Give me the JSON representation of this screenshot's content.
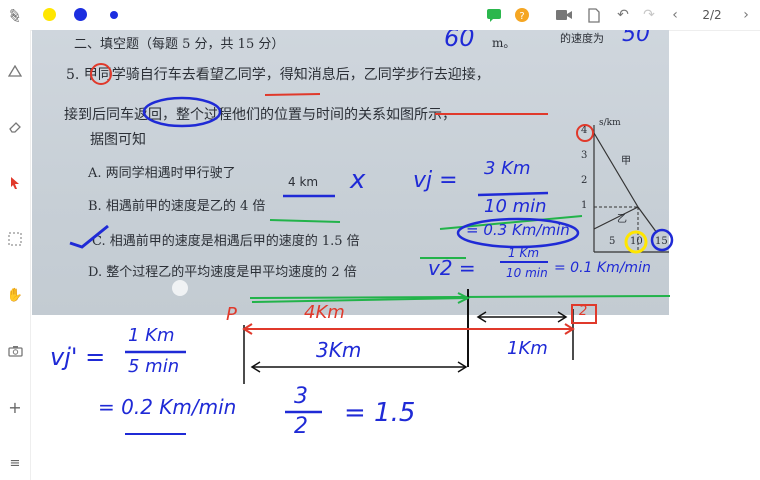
{
  "toolbar": {
    "pager": "2/2",
    "colors": {
      "yellow": "#ffe600",
      "blue": "#1c2ee0",
      "green": "#2bb74d",
      "orange": "#f5a623"
    }
  },
  "sidebar": {
    "tools": [
      "pen-icon",
      "shape-icon",
      "eraser-icon",
      "pointer-icon",
      "select-icon",
      "hand-icon",
      "camera-icon",
      "add-icon",
      "menu-icon"
    ]
  },
  "photo": {
    "header_line": "二、填空题（每题 5 分，共 15 分）",
    "header_answer": "60",
    "header_unit": "m。",
    "header_right": "的速度为",
    "header_right_answer": "50",
    "q5_line1": "5. 甲同学骑自行车去看望乙同学，得知消息后，乙同学步行去迎接，",
    "q5_line2": "接到后同车返回，整个过程他们的位置与时间的关系如图所示，",
    "q5_line3": "据图可知",
    "optA": "A.  两同学相遇时甲行驶了",
    "optA_ans": "4 km",
    "optB": "B.  相遇前甲的速度是乙的 4 倍",
    "optC": "C.  相遇前甲的速度是相遇后甲的速度的 1.5 倍",
    "optD": "D.  整个过程乙的平均速度是甲平均速度的 2 倍",
    "graph": {
      "ylabel": "s/km",
      "yticks": [
        "4",
        "3",
        "2",
        "1"
      ],
      "xticks": [
        "5",
        "10",
        "15"
      ],
      "label_jia": "甲",
      "label_yi": "乙"
    }
  },
  "handwriting": {
    "cross": "x",
    "vj": "vj =",
    "vj_num": "3 Km",
    "vj_den": "10 min",
    "vj_res": "= 0.3 Km/min",
    "v2": "v2 =",
    "v2_num": "1 Km",
    "v2_den": "10 min",
    "v2_res": "= 0.1 Km/min",
    "P": "P",
    "four_km": "4Km",
    "box2": "2",
    "three_km": "3Km",
    "one_km": "1Km",
    "vp": "vj' =",
    "vp_num": "1 Km",
    "vp_den": "5 min",
    "vp_res": "= 0.2 Km/min",
    "frac_num": "3",
    "frac_den": "2",
    "frac_res": "= 1.5"
  }
}
